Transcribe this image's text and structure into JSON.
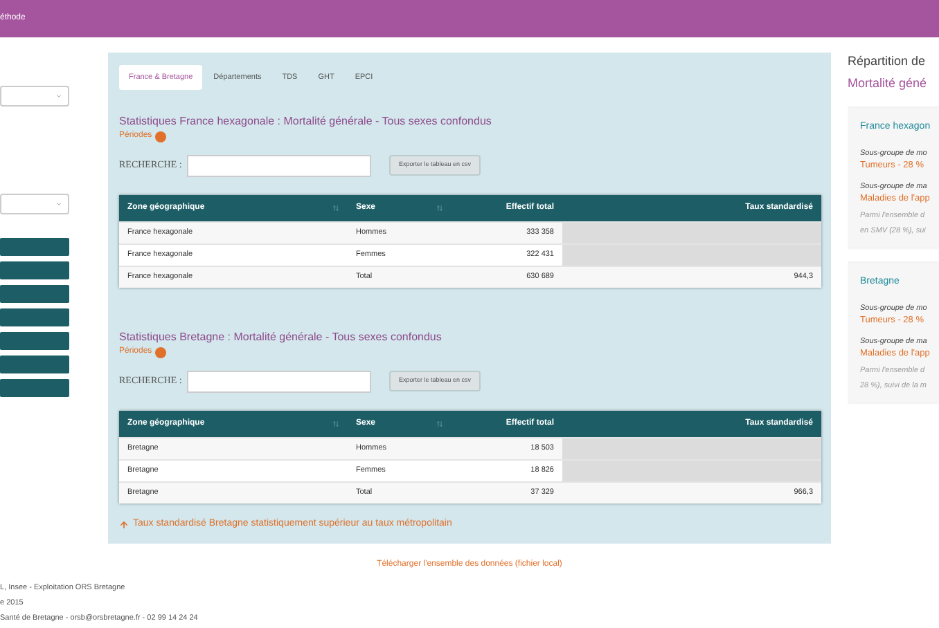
{
  "header": {
    "title": "éthode"
  },
  "tabs": [
    {
      "label": "France & Bretagne",
      "selected": true
    },
    {
      "label": "Départements",
      "selected": false
    },
    {
      "label": "TDS",
      "selected": false
    },
    {
      "label": "GHT",
      "selected": false
    },
    {
      "label": "EPCI",
      "selected": false
    }
  ],
  "sections": [
    {
      "title": "Statistiques France hexagonale : Mortalité générale - Tous sexes confondus",
      "periods": "Périodes",
      "search_label": "RECHERCHE :",
      "export_button": "Exporter le tableau en csv",
      "columns": [
        "Zone géographique",
        "Sexe",
        "Effectif total",
        "Taux standardisé"
      ],
      "rows": [
        [
          "France hexagonale",
          "Hommes",
          "333 358",
          null
        ],
        [
          "France hexagonale",
          "Femmes",
          "322 431",
          null
        ],
        [
          "France hexagonale",
          "Total",
          "630 689",
          "944,3"
        ]
      ]
    },
    {
      "title": "Statistiques Bretagne : Mortalité générale - Tous sexes confondus",
      "periods": "Périodes",
      "search_label": "RECHERCHE :",
      "export_button": "Exporter le tableau en csv",
      "columns": [
        "Zone géographique",
        "Sexe",
        "Effectif total",
        "Taux standardisé"
      ],
      "rows": [
        [
          "Bretagne",
          "Hommes",
          "18 503",
          null
        ],
        [
          "Bretagne",
          "Femmes",
          "18 826",
          null
        ],
        [
          "Bretagne",
          "Total",
          "37 329",
          "966,3"
        ]
      ],
      "note": "Taux standardisé Bretagne statistiquement supérieur au taux métropolitain"
    }
  ],
  "download_link": "Télécharger l'ensemble des données (fichier local)",
  "footer": [
    "L, Insee - Exploitation ORS Bretagne",
    "e 2015",
    "Santé de Bretagne - orsb@orsbretagne.fr - 02 99 14 24 24"
  ],
  "aside": {
    "title": "Répartition de",
    "subtitle": "Mortalité géné",
    "cards": [
      {
        "title": "France hexagon",
        "lines": [
          {
            "kind": "label",
            "text": "Sous-groupe de mo"
          },
          {
            "kind": "value",
            "text": "Tumeurs - 28 %"
          },
          {
            "kind": "label",
            "text": "Sous-groupe de ma"
          },
          {
            "kind": "value",
            "text": "Maladies de l'app"
          },
          {
            "kind": "note",
            "text": "Parmi l'ensemble d"
          },
          {
            "kind": "note",
            "text": "en SMV (28 %), sui"
          }
        ]
      },
      {
        "title": "Bretagne",
        "lines": [
          {
            "kind": "label",
            "text": "Sous-groupe de mo"
          },
          {
            "kind": "value",
            "text": "Tumeurs - 28 %"
          },
          {
            "kind": "label",
            "text": "Sous-groupe de ma"
          },
          {
            "kind": "value",
            "text": "Maladies de l'app"
          },
          {
            "kind": "note",
            "text": "Parmi l'ensemble d"
          },
          {
            "kind": "note",
            "text": "28 %), suivi de la m"
          }
        ]
      }
    ]
  }
}
